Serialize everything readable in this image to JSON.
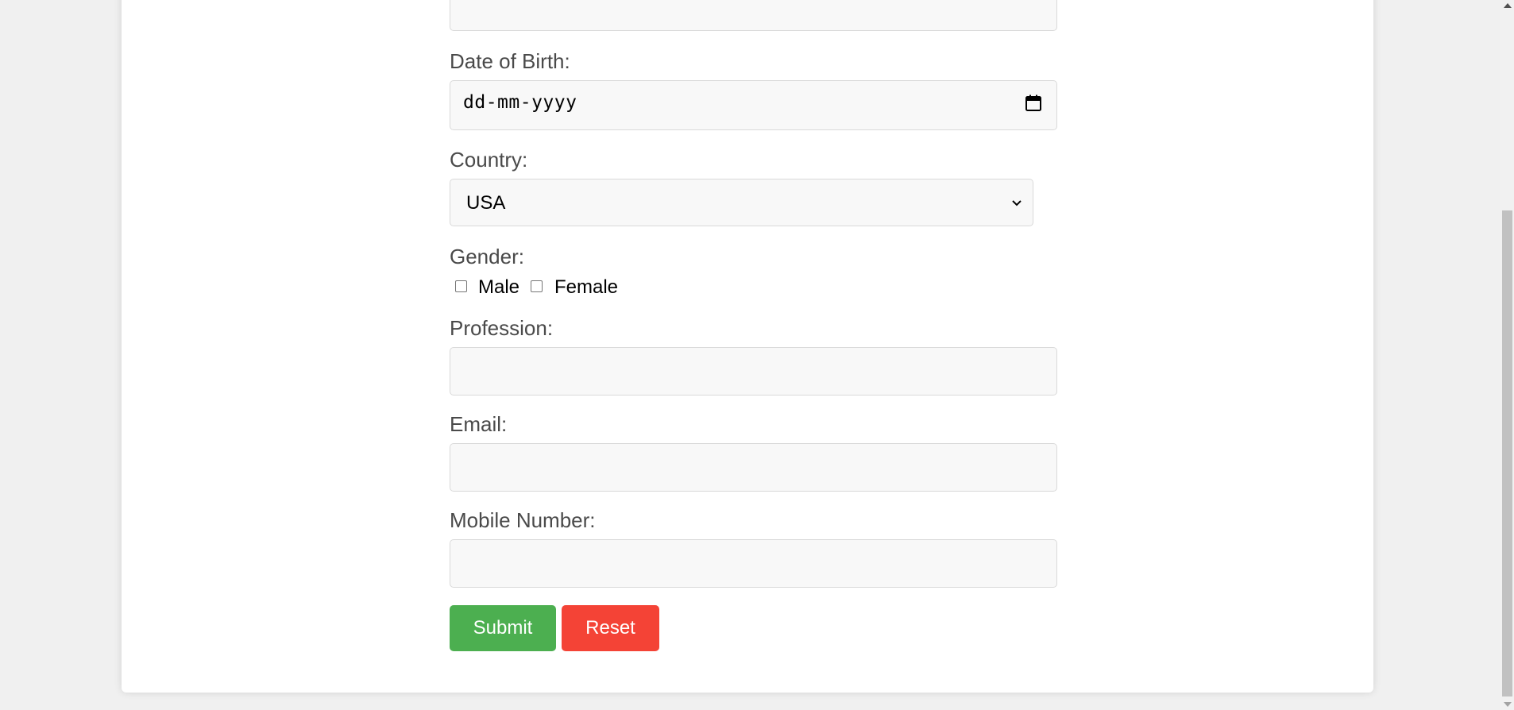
{
  "form": {
    "dob": {
      "label": "Date of Birth:",
      "placeholder": "dd-mm-yyyy",
      "icon": "calendar-icon"
    },
    "country": {
      "label": "Country:",
      "selected": "USA",
      "icon": "chevron-down-icon"
    },
    "gender": {
      "label": "Gender:",
      "options": [
        "Male",
        "Female"
      ]
    },
    "profession": {
      "label": "Profession:",
      "value": ""
    },
    "email": {
      "label": "Email:",
      "value": ""
    },
    "mobile": {
      "label": "Mobile Number:",
      "value": ""
    },
    "buttons": {
      "submit": "Submit",
      "reset": "Reset"
    }
  },
  "colors": {
    "submit": "#4caf50",
    "reset": "#f44336",
    "label": "#4a4a4a",
    "field_bg": "#f8f8f8"
  }
}
